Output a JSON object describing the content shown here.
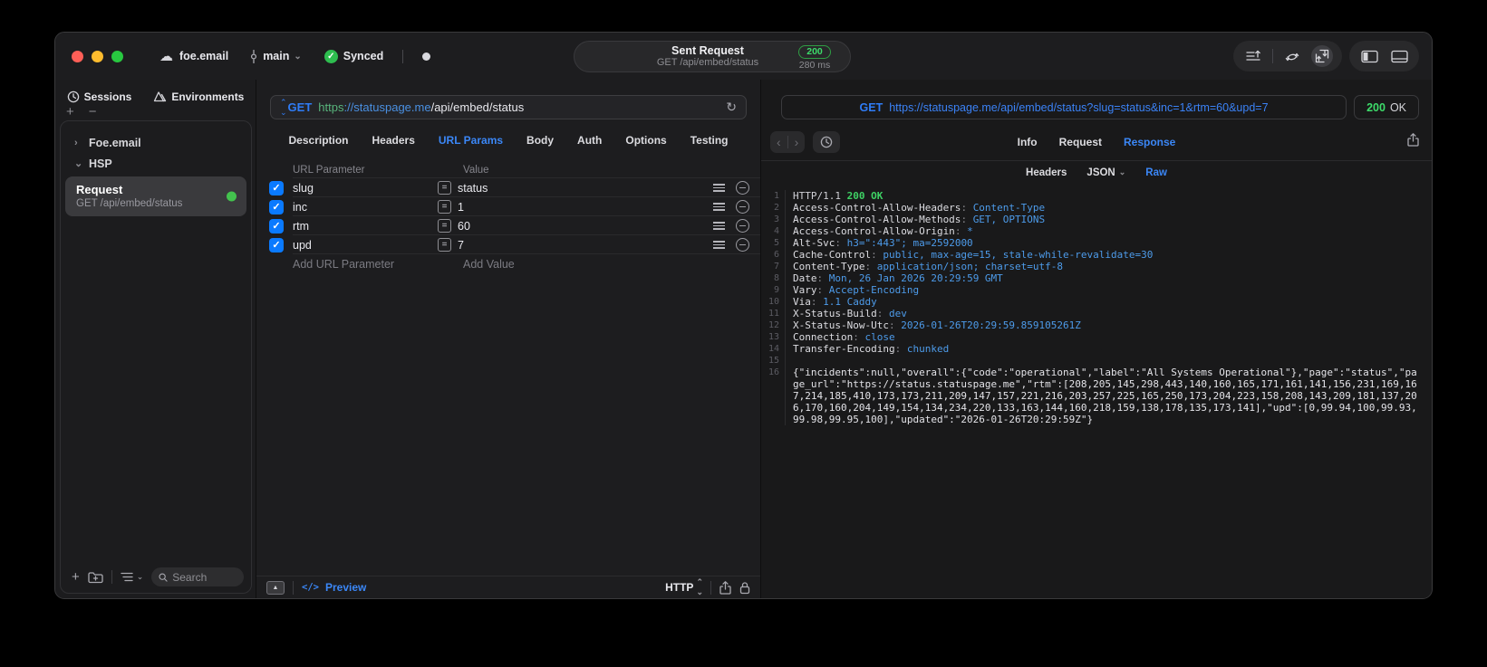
{
  "colors": {
    "accent": "#3b87f7",
    "success": "#32d74b",
    "checkbox_blue": "#0a7aff",
    "badge_green": "#3ddc6a"
  },
  "titlebar": {
    "project": "foe.email",
    "branch": "main",
    "sync_status": "Synced",
    "request_title": "Sent Request",
    "request_subtitle": "GET /api/embed/status",
    "status_code": "200",
    "duration": "280 ms"
  },
  "sidebar": {
    "tabs": [
      {
        "label": "Sessions"
      },
      {
        "label": "Environments"
      }
    ],
    "tree": [
      {
        "label": "Foe.email",
        "chevron": "›"
      },
      {
        "label": "HSP",
        "chevron": "⌄"
      }
    ],
    "request_item": {
      "title": "Request",
      "subtitle": "GET /api/embed/status"
    },
    "search_placeholder": "Search"
  },
  "request_panel": {
    "method": "GET",
    "url_scheme": "https",
    "url_host": "://statuspage.me",
    "url_path": "/api/embed/status",
    "tabs": [
      "Description",
      "Headers",
      "URL Params",
      "Body",
      "Auth",
      "Options",
      "Testing"
    ],
    "active_tab": "URL Params",
    "table": {
      "columns": [
        "URL Parameter",
        "Value"
      ],
      "rows": [
        {
          "name": "slug",
          "value": "status",
          "checked": true
        },
        {
          "name": "inc",
          "value": "1",
          "checked": true
        },
        {
          "name": "rtm",
          "value": "60",
          "checked": true
        },
        {
          "name": "upd",
          "value": "7",
          "checked": true
        }
      ],
      "add_param_placeholder": "Add URL Parameter",
      "add_value_placeholder": "Add Value"
    },
    "footer": {
      "preview_label": "Preview",
      "code_glyph": "</>",
      "http_label": "HTTP"
    }
  },
  "response_panel": {
    "method": "GET",
    "url": "https://statuspage.me/api/embed/status?slug=status&inc=1&rtm=60&upd=7",
    "status_code": "200",
    "status_text": "OK",
    "tabs": [
      "Info",
      "Request",
      "Response"
    ],
    "active_tab": "Response",
    "subtabs": [
      {
        "label": "Headers",
        "active": false,
        "chevron": false
      },
      {
        "label": "JSON",
        "active": false,
        "chevron": true
      },
      {
        "label": "Raw",
        "active": true,
        "chevron": false
      }
    ],
    "lines": [
      {
        "n": "1",
        "segs": [
          {
            "t": "HTTP/1.1 ",
            "c": "plain"
          },
          {
            "t": "200 OK",
            "c": "green"
          }
        ]
      },
      {
        "n": "2",
        "segs": [
          {
            "t": "Access-Control-Allow-Headers",
            "c": "name"
          },
          {
            "t": ": ",
            "c": "punct"
          },
          {
            "t": "Content-Type",
            "c": "value"
          }
        ]
      },
      {
        "n": "3",
        "segs": [
          {
            "t": "Access-Control-Allow-Methods",
            "c": "name"
          },
          {
            "t": ": ",
            "c": "punct"
          },
          {
            "t": "GET, OPTIONS",
            "c": "value"
          }
        ]
      },
      {
        "n": "4",
        "segs": [
          {
            "t": "Access-Control-Allow-Origin",
            "c": "name"
          },
          {
            "t": ": ",
            "c": "punct"
          },
          {
            "t": "*",
            "c": "value"
          }
        ]
      },
      {
        "n": "5",
        "segs": [
          {
            "t": "Alt-Svc",
            "c": "name"
          },
          {
            "t": ": ",
            "c": "punct"
          },
          {
            "t": "h3=\":443\"; ma=2592000",
            "c": "value"
          }
        ]
      },
      {
        "n": "6",
        "segs": [
          {
            "t": "Cache-Control",
            "c": "name"
          },
          {
            "t": ": ",
            "c": "punct"
          },
          {
            "t": "public, max-age=15, stale-while-revalidate=30",
            "c": "value"
          }
        ]
      },
      {
        "n": "7",
        "segs": [
          {
            "t": "Content-Type",
            "c": "name"
          },
          {
            "t": ": ",
            "c": "punct"
          },
          {
            "t": "application/json; charset=utf-8",
            "c": "value"
          }
        ]
      },
      {
        "n": "8",
        "segs": [
          {
            "t": "Date",
            "c": "name"
          },
          {
            "t": ": ",
            "c": "punct"
          },
          {
            "t": "Mon, 26 Jan 2026 20:29:59 GMT",
            "c": "value"
          }
        ]
      },
      {
        "n": "9",
        "segs": [
          {
            "t": "Vary",
            "c": "name"
          },
          {
            "t": ": ",
            "c": "punct"
          },
          {
            "t": "Accept-Encoding",
            "c": "value"
          }
        ]
      },
      {
        "n": "10",
        "segs": [
          {
            "t": "Via",
            "c": "name"
          },
          {
            "t": ": ",
            "c": "punct"
          },
          {
            "t": "1.1 Caddy",
            "c": "value"
          }
        ]
      },
      {
        "n": "11",
        "segs": [
          {
            "t": "X-Status-Build",
            "c": "name"
          },
          {
            "t": ": ",
            "c": "punct"
          },
          {
            "t": "dev",
            "c": "value"
          }
        ]
      },
      {
        "n": "12",
        "segs": [
          {
            "t": "X-Status-Now-Utc",
            "c": "name"
          },
          {
            "t": ": ",
            "c": "punct"
          },
          {
            "t": "2026-01-26T20:29:59.859105261Z",
            "c": "value"
          }
        ]
      },
      {
        "n": "13",
        "segs": [
          {
            "t": "Connection",
            "c": "name"
          },
          {
            "t": ": ",
            "c": "punct"
          },
          {
            "t": "close",
            "c": "value"
          }
        ]
      },
      {
        "n": "14",
        "segs": [
          {
            "t": "Transfer-Encoding",
            "c": "name"
          },
          {
            "t": ": ",
            "c": "punct"
          },
          {
            "t": "chunked",
            "c": "value"
          }
        ]
      },
      {
        "n": "15",
        "segs": []
      },
      {
        "n": "16",
        "segs": [
          {
            "t": "{\"incidents\":null,\"overall\":{\"code\":\"operational\",\"label\":\"All Systems Operational\"},\"page\":\"status\",\"page_url\":\"https://status.statuspage.me\",\"rtm\":[208,205,145,298,443,140,160,165,171,161,141,156,231,169,167,214,185,410,173,173,211,209,147,157,221,216,203,257,225,165,250,173,204,223,158,208,143,209,181,137,206,170,160,204,149,154,134,234,220,133,163,144,160,218,159,138,178,135,173,141],\"upd\":[0,99.94,100,99.93,99.98,99.95,100],\"updated\":\"2026-01-26T20:29:59Z\"}",
            "c": "body"
          }
        ]
      }
    ]
  }
}
